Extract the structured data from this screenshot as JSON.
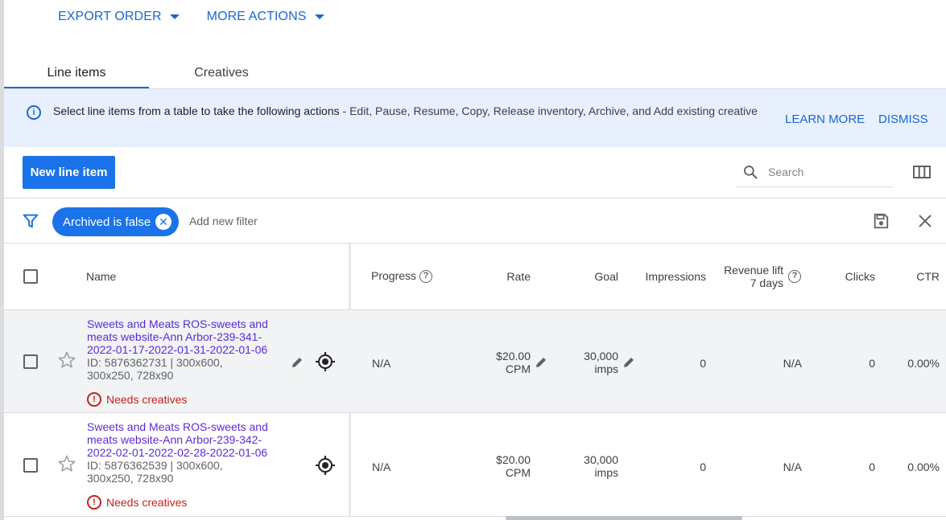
{
  "top_actions": {
    "export_order": "EXPORT ORDER",
    "more_actions": "MORE ACTIONS"
  },
  "tabs": [
    {
      "label": "Line items",
      "active": true
    },
    {
      "label": "Creatives",
      "active": false
    }
  ],
  "banner": {
    "icon": "info-icon",
    "strong": "Select line items from a table to take the following actions",
    "rest": " - Edit, Pause, Resume, Copy, Release inventory, Archive, and Add existing creative",
    "learn_more": "LEARN MORE",
    "dismiss": "DISMISS"
  },
  "toolbar": {
    "new_line_item": "New line item",
    "search_placeholder": "Search"
  },
  "filter": {
    "chip_label": "Archived is false",
    "add_filter": "Add new filter"
  },
  "table": {
    "columns": {
      "name": "Name",
      "progress": "Progress",
      "rate": "Rate",
      "goal": "Goal",
      "impressions": "Impressions",
      "revenue_lift_1": "Revenue lift",
      "revenue_lift_2": "7 days",
      "clicks": "Clicks",
      "ctr": "CTR"
    },
    "rows": [
      {
        "name": "Sweets and Meats ROS-sweets and meats website-Ann Arbor-239-341-2022-01-17-2022-01-31-2022-01-06",
        "meta": "ID: 5876362731 | 300x600, 300x250, 728x90",
        "warning": "Needs creatives",
        "progress": "N/A",
        "rate_value": "$20.00",
        "rate_unit": "CPM",
        "goal_value": "30,000",
        "goal_unit": "imps",
        "impressions": "0",
        "revenue_lift": "N/A",
        "clicks": "0",
        "ctr": "0.00%"
      },
      {
        "name": "Sweets and Meats ROS-sweets and meats website-Ann Arbor-239-342-2022-02-01-2022-02-28-2022-01-06",
        "meta": "ID: 5876362539 | 300x600, 300x250, 728x90",
        "warning": "Needs creatives",
        "progress": "N/A",
        "rate_value": "$20.00",
        "rate_unit": "CPM",
        "goal_value": "30,000",
        "goal_unit": "imps",
        "impressions": "0",
        "revenue_lift": "N/A",
        "clicks": "0",
        "ctr": "0.00%"
      }
    ]
  },
  "colors": {
    "accent": "#1a73e8",
    "link": "#1967d2",
    "item_link": "#5b2bd8",
    "warning": "#c5221f",
    "banner_bg": "#e8f0fe"
  }
}
